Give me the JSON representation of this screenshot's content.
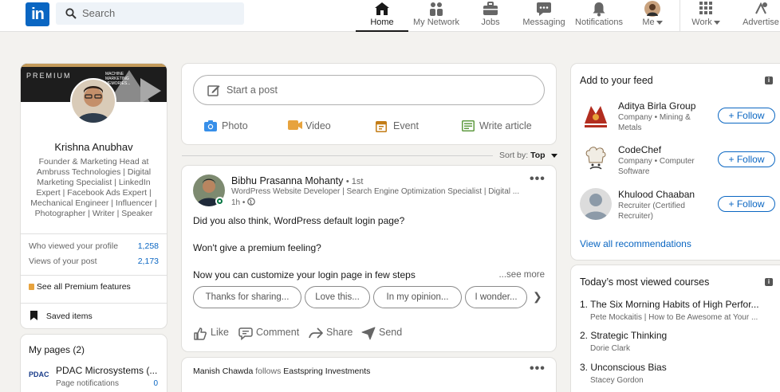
{
  "nav": {
    "logo": "in",
    "search_placeholder": "Search",
    "items": [
      {
        "label": "Home",
        "icon": "home-icon"
      },
      {
        "label": "My Network",
        "icon": "network-icon"
      },
      {
        "label": "Jobs",
        "icon": "briefcase-icon"
      },
      {
        "label": "Messaging",
        "icon": "messaging-icon"
      },
      {
        "label": "Notifications",
        "icon": "bell-icon"
      },
      {
        "label": "Me",
        "icon": "avatar"
      },
      {
        "label": "Work",
        "icon": "grid-icon"
      },
      {
        "label": "Advertise",
        "icon": "advertise-icon"
      }
    ]
  },
  "profile": {
    "banner_label": "PREMIUM",
    "banner_quote": "MACHINE MARKETING MEMORIES...",
    "name": "Krishna Anubhav",
    "headline": "Founder & Marketing Head at Ambruss Technologies | Digital Marketing Specialist | LinkedIn Expert | Facebook Ads Expert | Mechanical Engineer | Influencer | Photographer | Writer | Speaker",
    "stats": [
      {
        "label": "Who viewed your profile",
        "value": "1,258"
      },
      {
        "label": "Views of your post",
        "value": "2,173"
      }
    ],
    "premium_link": "See all Premium features",
    "saved_items": "Saved items"
  },
  "pages": {
    "title": "My pages (2)",
    "items": [
      {
        "name": "PDAC Microsystems (...",
        "sub": "Page notifications",
        "count": "0",
        "logo": "PDAC"
      }
    ]
  },
  "share_box": {
    "placeholder": "Start a post",
    "actions": [
      {
        "label": "Photo",
        "icon": "photo-icon",
        "color": "#378fe9"
      },
      {
        "label": "Video",
        "icon": "video-icon",
        "color": "#e7a33e"
      },
      {
        "label": "Event",
        "icon": "event-icon",
        "color": "#c37d16"
      },
      {
        "label": "Write article",
        "icon": "article-icon",
        "color": "#5f9b41"
      }
    ]
  },
  "sort": {
    "label": "Sort by:",
    "value": "Top"
  },
  "post": {
    "author": "Bibhu Prasanna Mohanty",
    "degree": "• 1st",
    "headline": "WordPress Website Developer | Search Engine Optimization Specialist | Digital ...",
    "time": "1h •",
    "lines": [
      "Did you also think, WordPress default login page?",
      "Won't give a premium feeling?",
      "Now you can customize your login page in few steps"
    ],
    "see_more": "...see more",
    "chips": [
      "Thanks for sharing...",
      "Love this...",
      "In my opinion...",
      "I wonder..."
    ],
    "actions": [
      {
        "label": "Like",
        "icon": "like-icon"
      },
      {
        "label": "Comment",
        "icon": "comment-icon"
      },
      {
        "label": "Share",
        "icon": "share-icon"
      },
      {
        "label": "Send",
        "icon": "send-icon"
      }
    ]
  },
  "next_post": {
    "actor": "Manish Chawda",
    "verb": "follows",
    "target": "Eastspring Investments"
  },
  "feed_recs": {
    "title": "Add to your feed",
    "follow_label": "+ Follow",
    "items": [
      {
        "name": "Aditya Birla Group",
        "sub": "Company • Mining & Metals"
      },
      {
        "name": "CodeChef",
        "sub": "Company • Computer Software"
      },
      {
        "name": "Khulood Chaaban",
        "sub": "Recruiter (Certified Recruiter)"
      }
    ],
    "view_all": "View all recommendations"
  },
  "courses": {
    "title": "Today’s most viewed courses",
    "items": [
      {
        "title": "1. The Six Morning Habits of High Perfor...",
        "sub": "Pete Mockaitis | How to Be Awesome at Your ..."
      },
      {
        "title": "2. Strategic Thinking",
        "sub": "Dorie Clark"
      },
      {
        "title": "3. Unconscious Bias",
        "sub": "Stacey Gordon"
      }
    ]
  }
}
